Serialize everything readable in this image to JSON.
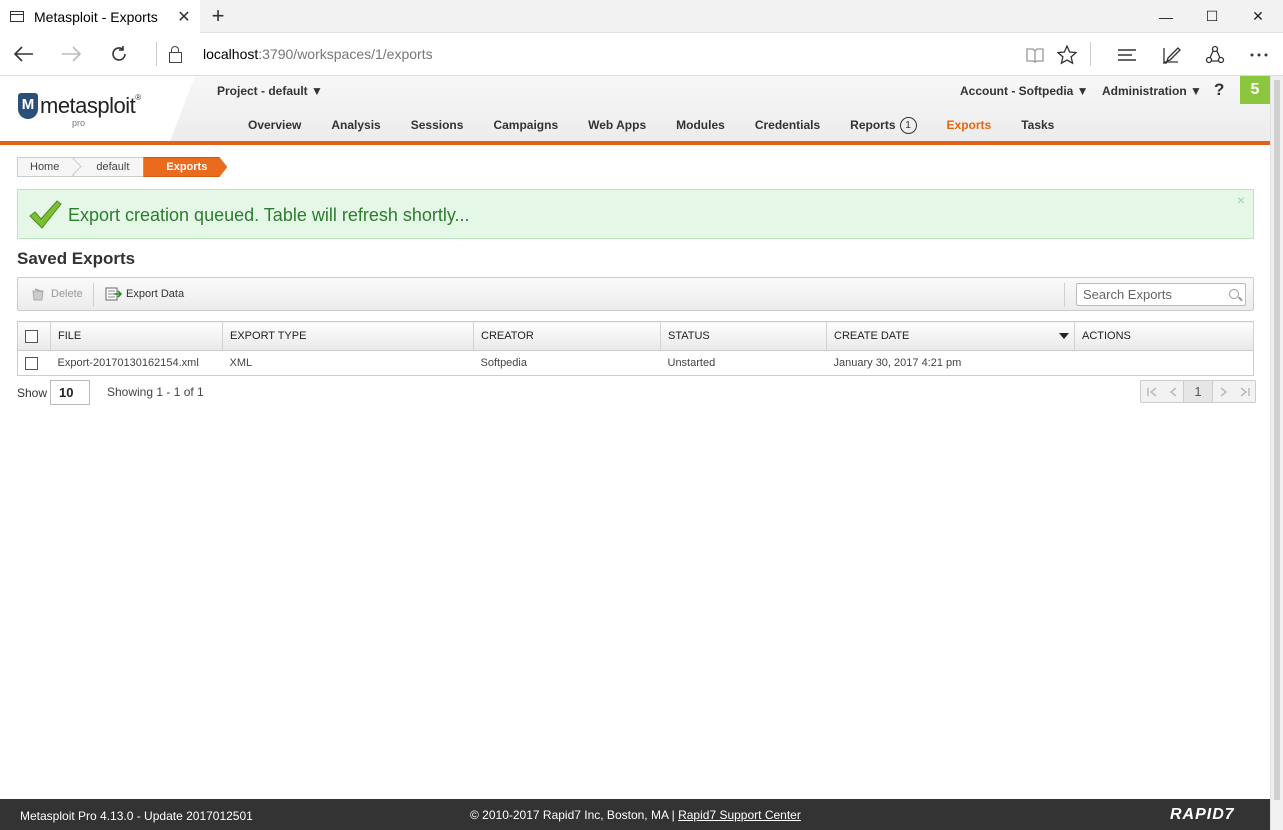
{
  "browser": {
    "tab_title": "Metasploit - Exports",
    "close_glyph": "✕",
    "new_tab_glyph": "+",
    "url_host": "localhost",
    "url_rest": ":3790/workspaces/1/exports",
    "window_controls": [
      "—",
      "☐",
      "✕"
    ]
  },
  "app": {
    "logo_text": "metasploit",
    "logo_sub": "pro",
    "project_selector": "Project - default ▼",
    "account_menu": "Account - Softpedia ▼",
    "admin_menu": "Administration ▼",
    "help": "?",
    "notification_count": "5",
    "nav": [
      {
        "label": "Overview"
      },
      {
        "label": "Analysis"
      },
      {
        "label": "Sessions"
      },
      {
        "label": "Campaigns"
      },
      {
        "label": "Web Apps"
      },
      {
        "label": "Modules"
      },
      {
        "label": "Credentials"
      },
      {
        "label": "Reports",
        "badge": "1"
      },
      {
        "label": "Exports",
        "active": true
      },
      {
        "label": "Tasks"
      }
    ]
  },
  "breadcrumb": [
    "Home",
    "default",
    "Exports"
  ],
  "flash": {
    "message": "Export creation queued. Table will refresh shortly...",
    "close": "×"
  },
  "section_title": "Saved Exports",
  "toolbar": {
    "delete_label": "Delete",
    "export_label": "Export Data",
    "search_placeholder": "Search Exports"
  },
  "table": {
    "columns": [
      "FILE",
      "EXPORT TYPE",
      "CREATOR",
      "STATUS",
      "CREATE DATE",
      "ACTIONS"
    ],
    "rows": [
      {
        "file": "Export-20170130162154.xml",
        "type": "XML",
        "creator": "Softpedia",
        "status": "Unstarted",
        "date": "January 30, 2017 4:21 pm",
        "actions": ""
      }
    ]
  },
  "pager": {
    "show_label": "Show",
    "per_page": "10",
    "showing": "Showing 1 - 1 of 1",
    "current_page": "1"
  },
  "footer": {
    "version": "Metasploit Pro 4.13.0 - Update 2017012501",
    "copyright": "© 2010-2017 Rapid7 Inc, Boston, MA | ",
    "support_link": "Rapid7 Support Center",
    "brand": "RAPID7"
  },
  "colors": {
    "accent": "#e35f1c",
    "success_bg": "#e5f7e7",
    "success_text": "#2c7d2e",
    "badge_green": "#8cc63f"
  }
}
